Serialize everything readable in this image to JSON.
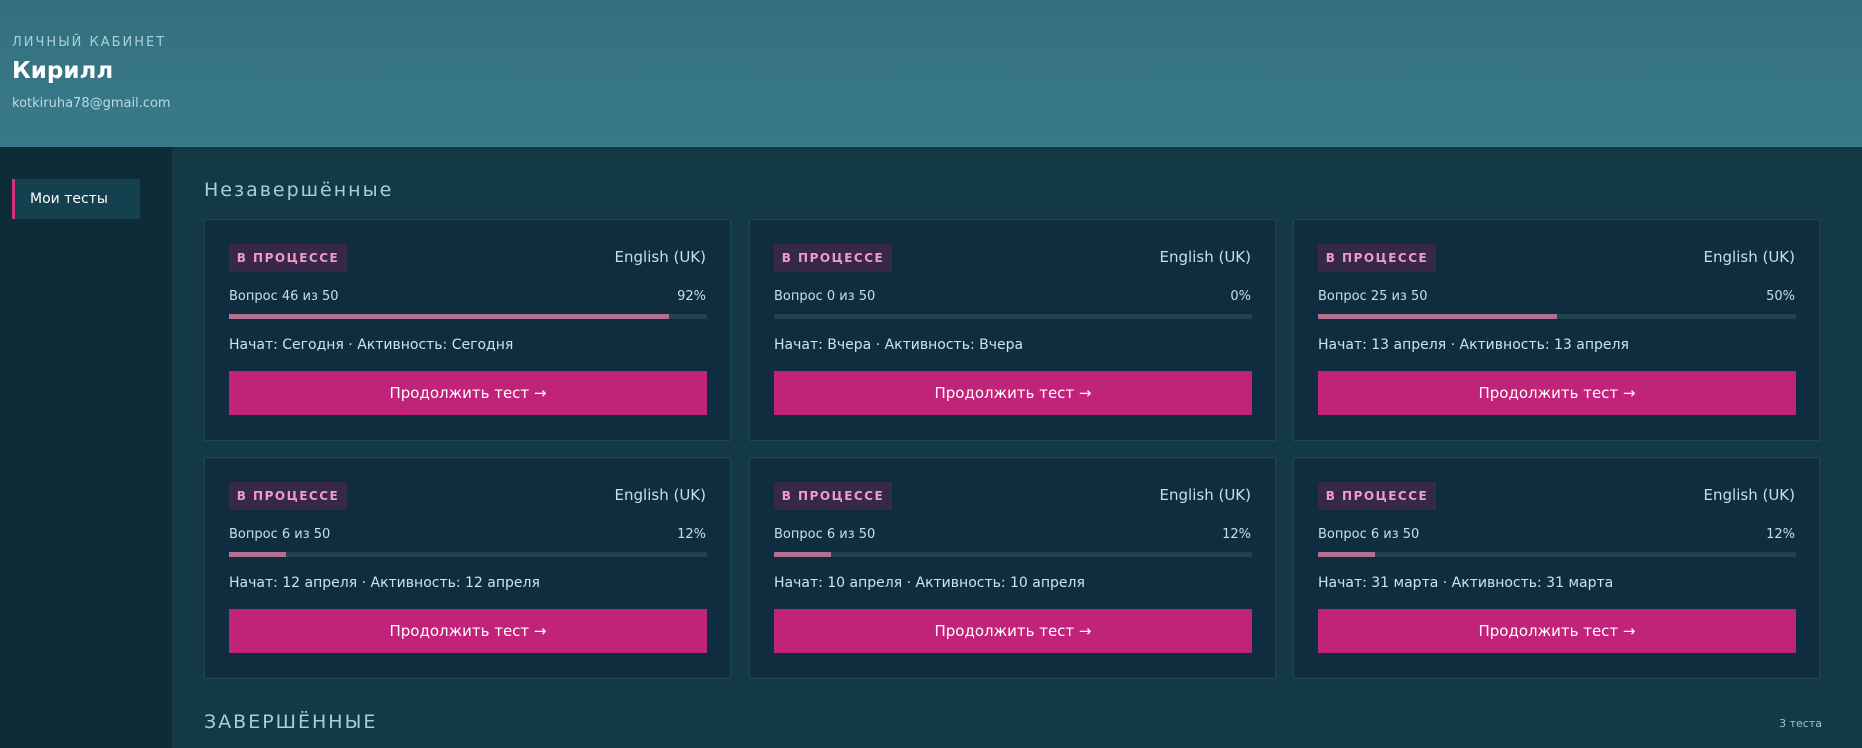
{
  "header": {
    "eyebrow": "ЛИЧНЫЙ КАБИНЕТ",
    "name": "Кирилл",
    "email": "kotkiruha78@gmail.com"
  },
  "sidebar": {
    "items": [
      {
        "label": "Мои тесты",
        "active": true
      }
    ]
  },
  "sections": {
    "incomplete": {
      "title": "Незавершённые"
    },
    "completed": {
      "title": "ЗАВЕРШЁННЫЕ",
      "count": "3 теста"
    }
  },
  "colors": {
    "accent": "#c1227a",
    "badge_bg": "#37284a",
    "badge_text": "#ef9cc6",
    "progress_fill": "#b0708f"
  },
  "cards": [
    {
      "badge": "В ПРОЦЕССЕ",
      "lang": "English (UK)",
      "question": "Вопрос 46 из 50",
      "percent_label": "92%",
      "progress": 0.92,
      "dates": "Начат: Сегодня · Активность: Сегодня",
      "cta": "Продолжить тест →"
    },
    {
      "badge": "В ПРОЦЕССЕ",
      "lang": "English (UK)",
      "question": "Вопрос 0 из 50",
      "percent_label": "0%",
      "progress": 0.0,
      "dates": "Начат: Вчера · Активность: Вчера",
      "cta": "Продолжить тест →"
    },
    {
      "badge": "В ПРОЦЕССЕ",
      "lang": "English (UK)",
      "question": "Вопрос 25 из 50",
      "percent_label": "50%",
      "progress": 0.5,
      "dates": "Начат: 13 апреля · Активность: 13 апреля",
      "cta": "Продолжить тест →"
    },
    {
      "badge": "В ПРОЦЕССЕ",
      "lang": "English (UK)",
      "question": "Вопрос 6 из 50",
      "percent_label": "12%",
      "progress": 0.12,
      "dates": "Начат: 12 апреля · Активность: 12 апреля",
      "cta": "Продолжить тест →"
    },
    {
      "badge": "В ПРОЦЕССЕ",
      "lang": "English (UK)",
      "question": "Вопрос 6 из 50",
      "percent_label": "12%",
      "progress": 0.12,
      "dates": "Начат: 10 апреля · Активность: 10 апреля",
      "cta": "Продолжить тест →"
    },
    {
      "badge": "В ПРОЦЕССЕ",
      "lang": "English (UK)",
      "question": "Вопрос 6 из 50",
      "percent_label": "12%",
      "progress": 0.12,
      "dates": "Начат: 31 марта · Активность: 31 марта",
      "cta": "Продолжить тест →"
    }
  ]
}
